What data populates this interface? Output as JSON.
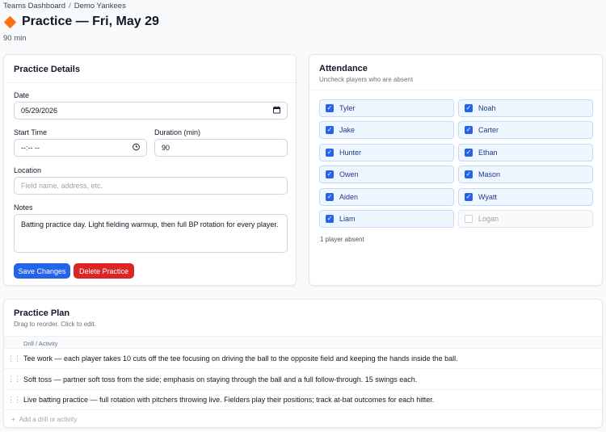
{
  "breadcrumb": {
    "root": "Teams Dashboard",
    "separator": "/",
    "current": "Demo Yankees"
  },
  "header": {
    "title": "Practice — Fri, May 29",
    "subtitle": "90 min",
    "icon": "practice-diamond-icon",
    "icon_color": "#f97316"
  },
  "details": {
    "title": "Practice Details",
    "date_label": "Date",
    "date_value": "05/29/2026",
    "start_time_label": "Start Time",
    "start_time_value": "--:-- --",
    "duration_label": "Duration (min)",
    "duration_value": "90",
    "location_label": "Location",
    "location_placeholder": "Field name, address, etc.",
    "notes_label": "Notes",
    "notes_value": "Batting practice day. Light fielding warmup, then full BP rotation for every player.",
    "save_label": "Save Changes",
    "delete_label": "Delete Practice",
    "save_color": "#2563eb",
    "delete_color": "#dc2626"
  },
  "attendance": {
    "title": "Attendance",
    "subtitle": "Uncheck players who are absent",
    "players": [
      {
        "name": "Tyler",
        "present": true
      },
      {
        "name": "Noah",
        "present": true
      },
      {
        "name": "Jake",
        "present": true
      },
      {
        "name": "Carter",
        "present": true
      },
      {
        "name": "Hunter",
        "present": true
      },
      {
        "name": "Ethan",
        "present": true
      },
      {
        "name": "Owen",
        "present": true
      },
      {
        "name": "Mason",
        "present": true
      },
      {
        "name": "Aiden",
        "present": true
      },
      {
        "name": "Wyatt",
        "present": true
      },
      {
        "name": "Liam",
        "present": true
      },
      {
        "name": "Logan",
        "present": false
      }
    ],
    "absent_summary": "1 player absent"
  },
  "plan": {
    "title": "Practice Plan",
    "subtitle": "Drag to reorder. Click to edit.",
    "column_header": "Drill / Activity",
    "drills": [
      "Tee work — each player takes 10 cuts off the tee focusing on driving the ball to the opposite field and keeping the hands inside the ball.",
      "Soft toss — partner soft toss from the side; emphasis on staying through the ball and a full follow-through. 15 swings each.",
      "Live batting practice — full rotation with pitchers throwing live. Fielders play their positions; track at-bat outcomes for each hitter."
    ],
    "add_label": "Add a drill or activity"
  }
}
